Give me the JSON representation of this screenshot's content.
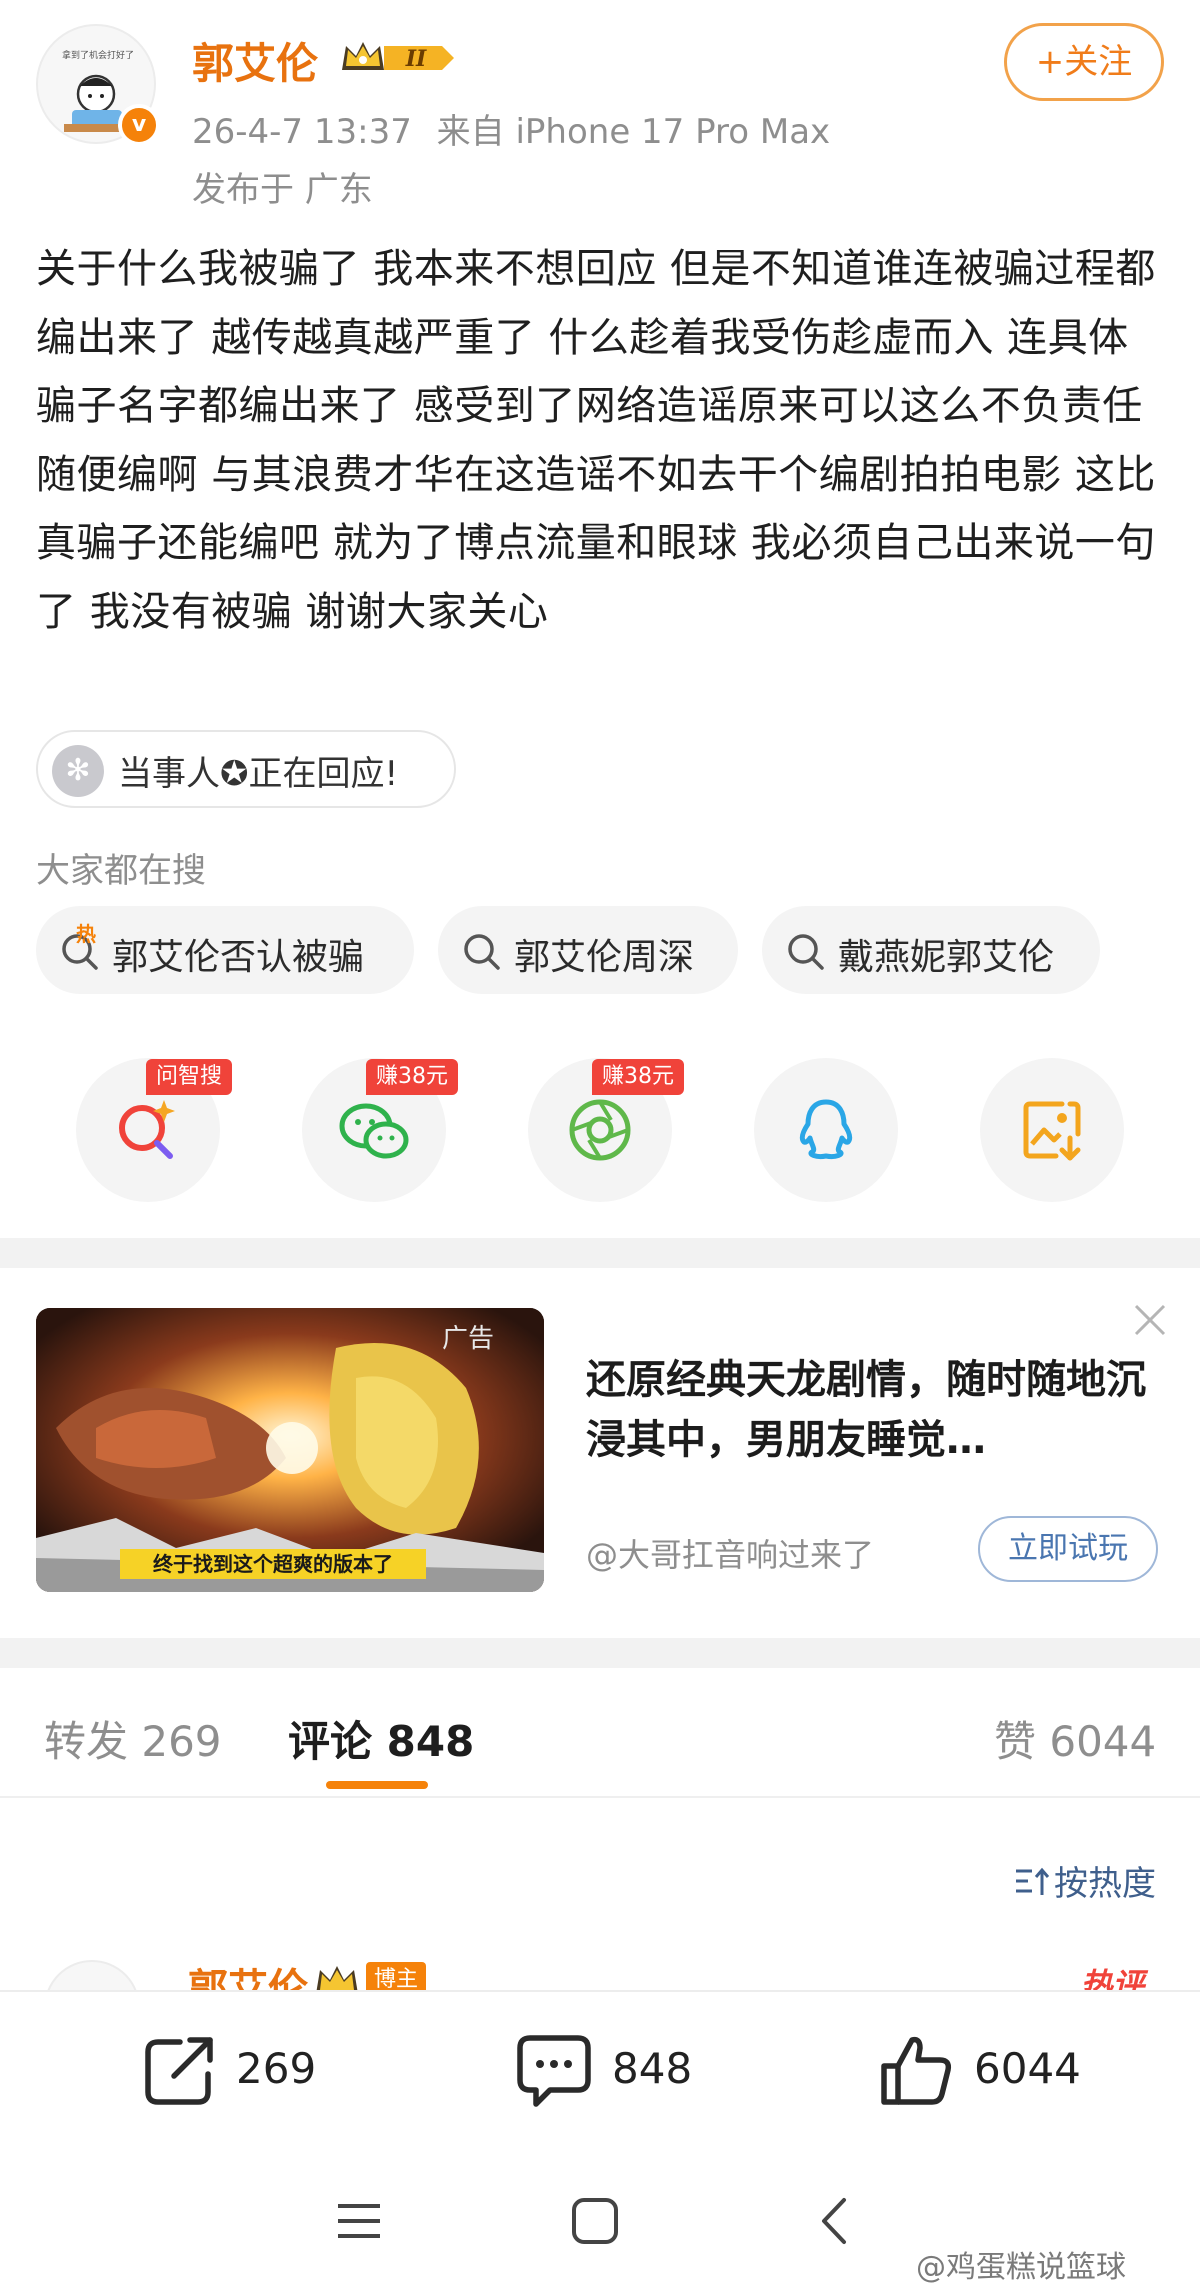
{
  "header": {
    "avatar_caption": "拿到了机会打好了",
    "username": "郭艾伦",
    "vip_level": "II",
    "timestamp": "26-4-7 13:37",
    "source": "来自 iPhone 17 Pro Max",
    "location": "发布于 广东",
    "follow_label": "+关注"
  },
  "post": {
    "text": "关于什么我被骗了 我本来不想回应 但是不知道谁连被骗过程都编出来了 越传越真越严重了 什么趁着我受伤趁虚而入 连具体骗子名字都编出来了  感受到了网络造谣原来可以这么不负责任 随便编啊  与其浪费才华在这造谣不如去干个编剧拍拍电影  这比真骗子还能编吧 就为了博点流量和眼球 我必须自己出来说一句了 我没有被骗 谢谢大家关心",
    "topic_pill": "当事人✪正在回应!"
  },
  "search": {
    "caption": "大家都在搜",
    "hot_mark": "热",
    "chips": [
      "郭艾伦否认被骗",
      "郭艾伦周深",
      "戴燕妮郭艾伦"
    ]
  },
  "share": {
    "items": [
      {
        "icon": "ai-search-icon",
        "tag": "问智搜",
        "color": "#f0433a"
      },
      {
        "icon": "wechat-icon",
        "tag": "赚38元",
        "color": "#2fb24c"
      },
      {
        "icon": "moments-icon",
        "tag": "赚38元",
        "color": "#5fb84a"
      },
      {
        "icon": "qq-icon",
        "tag": "",
        "color": "#2aa6e6"
      },
      {
        "icon": "save-image-icon",
        "tag": "",
        "color": "#f3a51d"
      }
    ]
  },
  "ad": {
    "tag": "广告",
    "banner": "终于找到这个超爽的版本了",
    "title": "还原经典天龙剧情，随时随地沉浸其中，男朋友睡觉…",
    "source": "@大哥扛音响过来了",
    "cta": "立即试玩"
  },
  "tabs": {
    "repost": "转发 269",
    "comments": "评论 848",
    "likes": "赞 6044"
  },
  "sort_label": "按热度",
  "comment_preview": {
    "name": "郭艾伦",
    "author_tag": "博主",
    "hot_label": "热评"
  },
  "actions": {
    "repost_count": "269",
    "comment_count": "848",
    "like_count": "6044"
  },
  "watermark": "@鸡蛋糕说篮球",
  "colors": {
    "accent": "#f5820a",
    "username": "#e8720f",
    "link": "#3f5f8c",
    "hot": "#f0433a"
  }
}
